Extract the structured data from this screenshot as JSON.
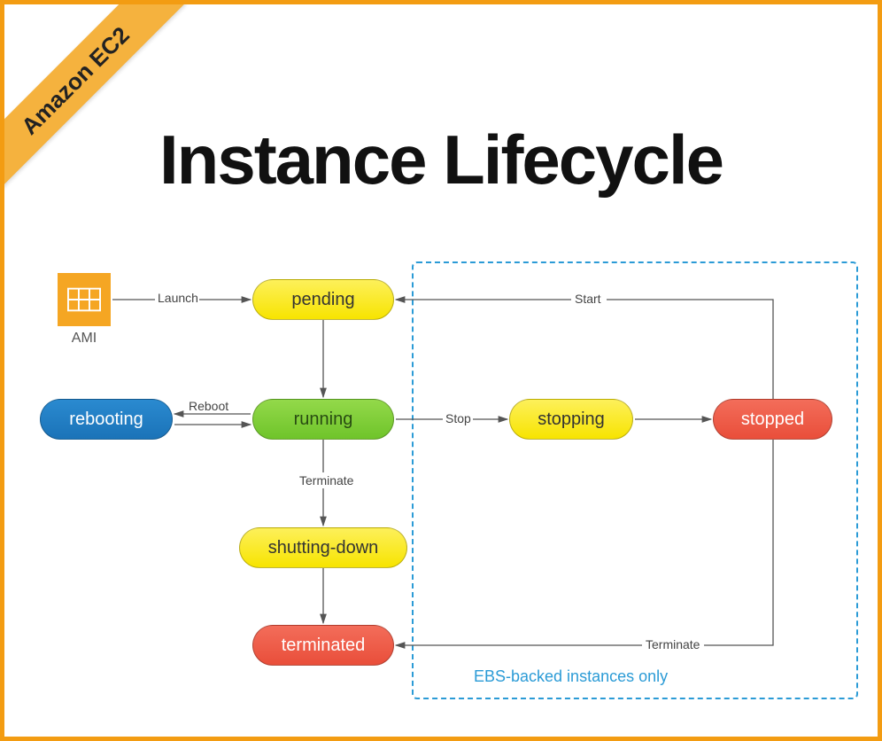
{
  "ribbon": "Amazon EC2",
  "title": "Instance Lifecycle",
  "ami": {
    "label": "AMI"
  },
  "nodes": {
    "pending": "pending",
    "running": "running",
    "rebooting": "rebooting",
    "stopping": "stopping",
    "stopped": "stopped",
    "shutting_down": "shutting-down",
    "terminated": "terminated"
  },
  "edges": {
    "launch": "Launch",
    "reboot": "Reboot",
    "stop": "Stop",
    "start": "Start",
    "terminate_running": "Terminate",
    "terminate_stopped": "Terminate"
  },
  "ebs_caption": "EBS-backed instances only"
}
